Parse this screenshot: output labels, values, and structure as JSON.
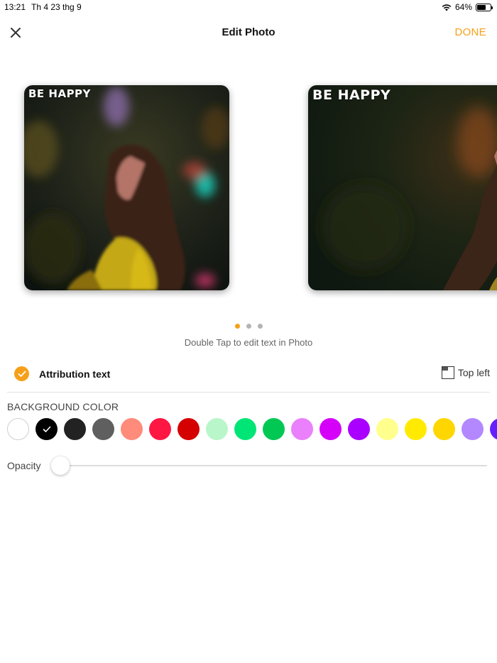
{
  "status_bar": {
    "time": "13:21",
    "date": "Th 4 23 thg 9",
    "battery": "64%",
    "battery_level": 0.64,
    "icons": [
      "wifi-icon",
      "battery-icon"
    ]
  },
  "nav": {
    "title": "Edit Photo",
    "done_label": "DONE",
    "close_icon": "close-icon"
  },
  "carousel": {
    "cards": [
      {
        "text": "BE HAPPY"
      },
      {
        "text": "BE HAPPY"
      }
    ],
    "page_count": 3,
    "active_page": 1,
    "hint": "Double Tap to edit text in Photo"
  },
  "attribution": {
    "label": "Attribution text",
    "checked": true,
    "position_label": "Top left",
    "position_icon": "top-left-position-icon"
  },
  "background_color": {
    "title": "BACKGROUND COLOR",
    "selected": "#000000",
    "swatches": [
      "#ffffff",
      "#000000",
      "#222222",
      "#5f5f5f",
      "#ff8b7b",
      "#ff1744",
      "#d50000",
      "#b9f6ca",
      "#00e676",
      "#00c853",
      "#ea80fc",
      "#d500f9",
      "#aa00ff",
      "#ffff8d",
      "#ffea00",
      "#ffd600",
      "#b388ff",
      "#651fff"
    ]
  },
  "opacity": {
    "label": "Opacity",
    "value": 0.0
  },
  "colors": {
    "accent": "#f6a019"
  }
}
